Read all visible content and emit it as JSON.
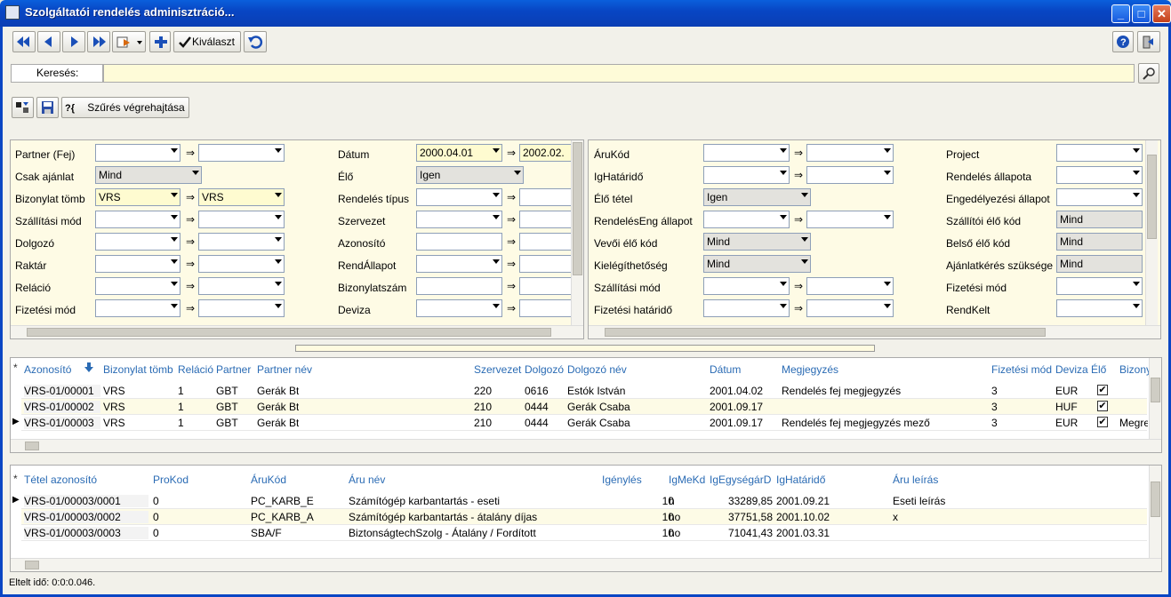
{
  "window": {
    "title": "Szolgáltatói rendelés adminisztráció..."
  },
  "toolbar": {
    "kivalaszt": "Kiválaszt"
  },
  "search": {
    "label": "Keresés:",
    "value": ""
  },
  "filterbar": {
    "szures": "Szűrés végrehajtása"
  },
  "left_filter": {
    "partner": "Partner (Fej)",
    "csak_ajanlat": "Csak ajánlat",
    "csak_ajanlat_val": "Mind",
    "biz_tomb": "Bizonylat tömb",
    "biz_tomb_from": "VRS",
    "biz_tomb_to": "VRS",
    "szall_mod": "Szállítási mód",
    "dolgozo": "Dolgozó",
    "raktar": "Raktár",
    "relacio": "Reláció",
    "fiz_mod": "Fizetési mód",
    "datum": "Dátum",
    "datum_from": "2000.04.01",
    "datum_to": "2002.02.",
    "elo": "Élő",
    "elo_val": "Igen",
    "rend_tipus": "Rendelés típus",
    "szervezet": "Szervezet",
    "azonosito": "Azonosító",
    "rend_allapot": "RendÁllapot",
    "biz_szam": "Bizonylatszám",
    "deviza": "Deviza"
  },
  "right_filter": {
    "arukod": "ÁruKód",
    "ighatarido": "IgHatáridő",
    "elo_tetel": "Élő tétel",
    "elo_tetel_val": "Igen",
    "rend_eng": "RendelésEng állapot",
    "vevoi_elo": "Vevői élő kód",
    "vevoi_elo_val": "Mind",
    "kielegithetoseg": "Kielégíthetőség",
    "kielegithetoseg_val": "Mind",
    "szall_mod": "Szállítási mód",
    "fiz_hatarido": "Fizetési határidő",
    "project": "Project",
    "rend_allapota": "Rendelés állapota",
    "eng_allapot": "Engedélyezési állapot",
    "szall_elo": "Szállítói élő kód",
    "szall_elo_val": "Mind",
    "belso_elo": "Belső élő kód",
    "belso_elo_val": "Mind",
    "ajanlatkeres": "Ajánlatkérés szüksége",
    "ajanlatkeres_val": "Mind",
    "fiz_mod": "Fizetési mód",
    "rendkelt": "RendKelt"
  },
  "orders": {
    "headers": [
      "Azonosító",
      "Bizonylat tömb",
      "Reláció",
      "Partner",
      "Partner név",
      "Szervezet",
      "Dolgozó",
      "Dolgozó név",
      "Dátum",
      "Megjegyzés",
      "Fizetési mód",
      "Deviza",
      "Élő",
      "Bizony"
    ],
    "rows": [
      [
        "VRS-01/00001",
        "VRS",
        "1",
        "GBT",
        "Gerák Bt",
        "220",
        "0616",
        "Estók István",
        "2001.04.02",
        "Rendelés fej megjegyzés",
        "3",
        "EUR",
        "✔",
        ""
      ],
      [
        "VRS-01/00002",
        "VRS",
        "1",
        "GBT",
        "Gerák Bt",
        "210",
        "0444",
        "Gerák Csaba",
        "2001.09.17",
        "",
        "3",
        "HUF",
        "✔",
        ""
      ],
      [
        "VRS-01/00003",
        "VRS",
        "1",
        "GBT",
        "Gerák Bt",
        "210",
        "0444",
        "Gerák Csaba",
        "2001.09.17",
        "Rendelés fej megjegyzés mező",
        "3",
        "EUR",
        "✔",
        "Megre"
      ]
    ]
  },
  "items": {
    "headers": [
      "Tétel azonosító",
      "ProKod",
      "ÁruKód",
      "Áru név",
      "Igénylés",
      "IgMeKd",
      "IgEgységárD",
      "IgHatáridő",
      "Áru leírás"
    ],
    "rows": [
      [
        "VRS-01/00003/0001",
        "0",
        "PC_KARB_E",
        "Számítógép karbantartás - eseti",
        "10",
        "h",
        "33289,85",
        "2001.09.21",
        "Eseti leírás"
      ],
      [
        "VRS-01/00003/0002",
        "0",
        "PC_KARB_A",
        "Számítógép karbantartás - átalány díjas",
        "10",
        "ho",
        "37751,58",
        "2001.10.02",
        "x"
      ],
      [
        "VRS-01/00003/0003",
        "0",
        "SBA/F",
        "BiztonságtechSzolg - Átalány / Fordított",
        "10",
        "ho",
        "71041,43",
        "2001.03.31",
        ""
      ]
    ]
  },
  "status": {
    "text": "Eltelt idő: 0:0:0.046."
  }
}
